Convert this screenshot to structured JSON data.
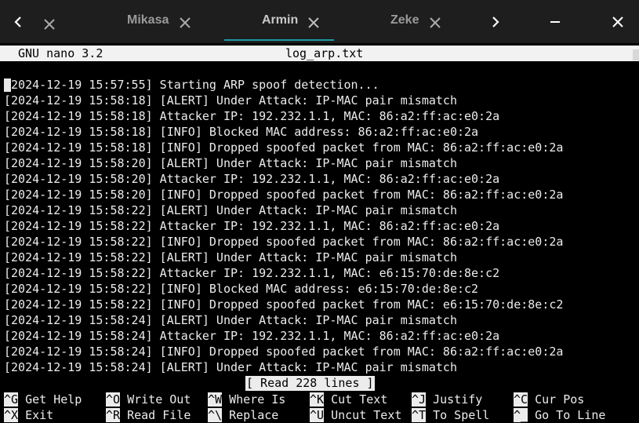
{
  "tabs": [
    {
      "title": "Mikasa",
      "active": false
    },
    {
      "title": "Armin",
      "active": true
    },
    {
      "title": "Zeke",
      "active": false
    }
  ],
  "icons": {
    "prev": "chevron-left-icon",
    "next": "chevron-right-icon",
    "close": "close-icon",
    "minimize": "minimize-icon"
  },
  "colors": {
    "accent": "#1a9aa6"
  },
  "nano": {
    "version": "GNU nano 3.2",
    "filename": "log_arp.txt",
    "status": "[ Read 228 lines ]"
  },
  "log_lines": [
    "[2024-12-19 15:57:55] Starting ARP spoof detection...",
    "[2024-12-19 15:58:18] [ALERT] Under Attack: IP-MAC pair mismatch",
    "[2024-12-19 15:58:18] Attacker IP: 192.232.1.1, MAC: 86:a2:ff:ac:e0:2a",
    "[2024-12-19 15:58:18] [INFO] Blocked MAC address: 86:a2:ff:ac:e0:2a",
    "[2024-12-19 15:58:18] [INFO] Dropped spoofed packet from MAC: 86:a2:ff:ac:e0:2a",
    "[2024-12-19 15:58:20] [ALERT] Under Attack: IP-MAC pair mismatch",
    "[2024-12-19 15:58:20] Attacker IP: 192.232.1.1, MAC: 86:a2:ff:ac:e0:2a",
    "[2024-12-19 15:58:20] [INFO] Dropped spoofed packet from MAC: 86:a2:ff:ac:e0:2a",
    "[2024-12-19 15:58:22] [ALERT] Under Attack: IP-MAC pair mismatch",
    "[2024-12-19 15:58:22] Attacker IP: 192.232.1.1, MAC: 86:a2:ff:ac:e0:2a",
    "[2024-12-19 15:58:22] [INFO] Dropped spoofed packet from MAC: 86:a2:ff:ac:e0:2a",
    "[2024-12-19 15:58:22] [ALERT] Under Attack: IP-MAC pair mismatch",
    "[2024-12-19 15:58:22] Attacker IP: 192.232.1.1, MAC: e6:15:70:de:8e:c2",
    "[2024-12-19 15:58:22] [INFO] Blocked MAC address: e6:15:70:de:8e:c2",
    "[2024-12-19 15:58:22] [INFO] Dropped spoofed packet from MAC: e6:15:70:de:8e:c2",
    "[2024-12-19 15:58:24] [ALERT] Under Attack: IP-MAC pair mismatch",
    "[2024-12-19 15:58:24] Attacker IP: 192.232.1.1, MAC: 86:a2:ff:ac:e0:2a",
    "[2024-12-19 15:58:24] [INFO] Dropped spoofed packet from MAC: 86:a2:ff:ac:e0:2a",
    "[2024-12-19 15:58:24] [ALERT] Under Attack: IP-MAC pair mismatch"
  ],
  "shortcuts": {
    "row1": [
      {
        "key": "^G",
        "label": "Get Help"
      },
      {
        "key": "^O",
        "label": "Write Out"
      },
      {
        "key": "^W",
        "label": "Where Is"
      },
      {
        "key": "^K",
        "label": "Cut Text"
      },
      {
        "key": "^J",
        "label": "Justify"
      },
      {
        "key": "^C",
        "label": "Cur Pos"
      }
    ],
    "row2": [
      {
        "key": "^X",
        "label": "Exit"
      },
      {
        "key": "^R",
        "label": "Read File"
      },
      {
        "key": "^\\",
        "label": "Replace"
      },
      {
        "key": "^U",
        "label": "Uncut Text"
      },
      {
        "key": "^T",
        "label": "To Spell"
      },
      {
        "key": "^_",
        "label": "Go To Line"
      }
    ]
  }
}
